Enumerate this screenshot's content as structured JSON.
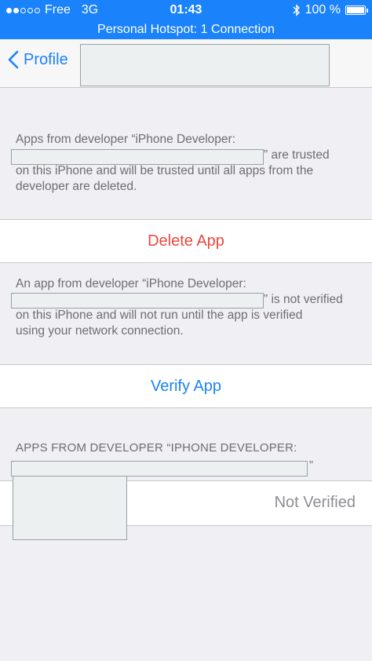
{
  "status_bar": {
    "carrier": "Free",
    "network": "3G",
    "time": "01:43",
    "battery": "100 %",
    "battery_level": 1.0
  },
  "hotspot": {
    "text": "Personal Hotspot: 1 Connection"
  },
  "nav": {
    "back_label": "Profile"
  },
  "section1": {
    "line1": "Apps from developer “iPhone Developer:",
    "line2_suffix": "” are trusted",
    "line3": "on this iPhone and will be trusted until all apps from the",
    "line4": "developer are deleted."
  },
  "delete_button": {
    "label": "Delete App"
  },
  "section2": {
    "line1": "An app from developer “iPhone Developer:",
    "line2_suffix": "” is not verified",
    "line3": "on this iPhone and will not run until the app is verified",
    "line4": "using your network connection."
  },
  "verify_button": {
    "label": "Verify App"
  },
  "apps_header": {
    "line1": "APPS FROM DEVELOPER “IPHONE DEVELOPER:",
    "line2_suffix": "”"
  },
  "app_row": {
    "status": "Not Verified"
  },
  "colors": {
    "accent": "#1a82fb",
    "destructive": "#e8483f",
    "secondary_text": "#6d6d72",
    "background": "#efeff4"
  }
}
